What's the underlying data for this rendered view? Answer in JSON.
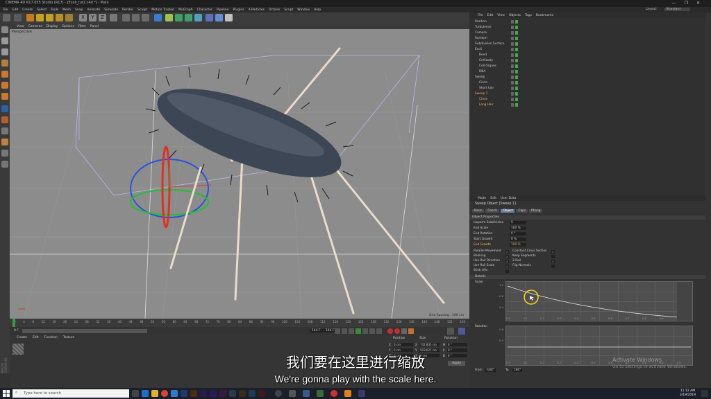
{
  "window": {
    "title": "CINEMA 4D R17.055 Studio (R17) - [Ecoli_tut2.c4d *] - Main",
    "controls": [
      "—",
      "❐",
      "✕"
    ]
  },
  "menubar": {
    "items": [
      "File",
      "Edit",
      "Create",
      "Select",
      "Tools",
      "Mesh",
      "Snap",
      "Animate",
      "Simulate",
      "Render",
      "Sculpt",
      "Motion Tracker",
      "MoGraph",
      "Character",
      "Pipeline",
      "Plugins",
      "X-Particles",
      "Octane",
      "Script",
      "Window",
      "Help"
    ],
    "layout_label": "Layout:",
    "layout_value": "Standard"
  },
  "viewport": {
    "menu": [
      "View",
      "Cameras",
      "Display",
      "Options",
      "Filter",
      "Panel"
    ],
    "label": "Perspective",
    "grid_spacing": "Grid Spacing : 100 cm"
  },
  "timeline": {
    "ticks": [
      "0",
      "4",
      "8",
      "12",
      "16",
      "20",
      "24",
      "28",
      "32",
      "36",
      "40",
      "44",
      "48",
      "52",
      "56",
      "60",
      "64",
      "68",
      "72",
      "76",
      "80",
      "84",
      "88",
      "92",
      "96",
      "100",
      "104",
      "108",
      "112",
      "116",
      "120",
      "124",
      "128",
      "132",
      "136",
      "140",
      "144",
      "148",
      "152",
      "156"
    ],
    "current_frame": "0 F",
    "start": "0 F",
    "end": "144 F",
    "end2": "144 F"
  },
  "material_manager": {
    "menu": [
      "Create",
      "Edit",
      "Function",
      "Texture"
    ]
  },
  "coordinates": {
    "headers": [
      "Position",
      "Size",
      "Rotation"
    ],
    "rows": [
      {
        "p": "X",
        "pv": "0 cm",
        "s": "X",
        "sv": "742.835 cm",
        "r": "H",
        "rv": "0 °"
      },
      {
        "p": "Y",
        "pv": "0 cm",
        "s": "Y",
        "sv": "503.621 cm",
        "r": "P",
        "rv": "0 °"
      },
      {
        "p": "Z",
        "pv": "0 cm",
        "s": "Z",
        "sv": "0 cm",
        "r": "B",
        "rv": "0 °"
      }
    ],
    "apply": "Apply"
  },
  "object_manager": {
    "menu": [
      "File",
      "Edit",
      "View",
      "Objects",
      "Tags",
      "Bookmarks"
    ],
    "objects": [
      {
        "name": "Position",
        "indent": 1
      },
      {
        "name": "Turbulence",
        "indent": 1
      },
      {
        "name": "Camera",
        "indent": 1
      },
      {
        "name": "Random",
        "indent": 1
      },
      {
        "name": "Subdivision Surface",
        "indent": 1
      },
      {
        "name": "Ecoli",
        "indent": 1
      },
      {
        "name": "Bend",
        "indent": 2
      },
      {
        "name": "Cell body",
        "indent": 2
      },
      {
        "name": "Cell Organs",
        "indent": 2
      },
      {
        "name": "DNA",
        "indent": 2
      },
      {
        "name": "Sweep",
        "indent": 1
      },
      {
        "name": "Circle",
        "indent": 2
      },
      {
        "name": "Short hair",
        "indent": 2
      },
      {
        "name": "Sweep 1",
        "indent": 1
      },
      {
        "name": "Circle",
        "indent": 2
      },
      {
        "name": "Long Hair",
        "indent": 2
      }
    ]
  },
  "attributes": {
    "menu": [
      "Mode",
      "Edit",
      "User Data"
    ],
    "title": "Sweep Object [Sweep 1]",
    "tabs": [
      "Basic",
      "Coord.",
      "Object",
      "Caps",
      "Phong"
    ],
    "section": "Object Properties",
    "props": [
      {
        "label": "Isoparm Subdivision",
        "value": "5"
      },
      {
        "label": "End Scale",
        "value": "100 %"
      },
      {
        "label": "End Rotation",
        "value": "0 °"
      },
      {
        "label": "Start Growth",
        "value": "0 %"
      },
      {
        "label": "End Growth",
        "value": "100 %"
      }
    ],
    "checks_left": [
      {
        "label": "Parallel Movement",
        "on": "✓"
      },
      {
        "label": "Banking",
        "on": "✓"
      },
      {
        "label": "Use Rail Direction",
        "on": "✓"
      },
      {
        "label": "Use Rail Scale",
        "on": "✓"
      },
      {
        "label": "Stick UVs",
        "on": ""
      }
    ],
    "checks_right": [
      {
        "label": "Constant Cross Section",
        "on": "✓"
      },
      {
        "label": "Keep Segments",
        "on": ""
      },
      {
        "label": "2-Rail",
        "on": "✓"
      },
      {
        "label": "Flip Normals",
        "on": ""
      }
    ],
    "details": "Details",
    "scale_label": "Scale",
    "rotation_label": "Rotation",
    "graph_y": [
      "1.2",
      "0.8",
      "0.4"
    ],
    "graph_x": [
      "0.0",
      "0.1",
      "0.2",
      "0.3",
      "0.4",
      "0.5",
      "0.6",
      "0.7",
      "0.8",
      "0.9",
      "1.0"
    ],
    "rot_y": [
      "0.8",
      "0.4"
    ],
    "from_label": "From",
    "from_value": "-180°",
    "to_label": "To",
    "to_value": "180°"
  },
  "subtitles": {
    "zh": "我们要在这里进行缩放",
    "en": "We're gonna play with the scale here."
  },
  "watermark": {
    "line1": "Activate Windows",
    "line2": "Go to Settings to activate Windows."
  },
  "taskbar": {
    "search": "Type here to search",
    "time": "11:12 AM",
    "date": "3/19/2019"
  }
}
